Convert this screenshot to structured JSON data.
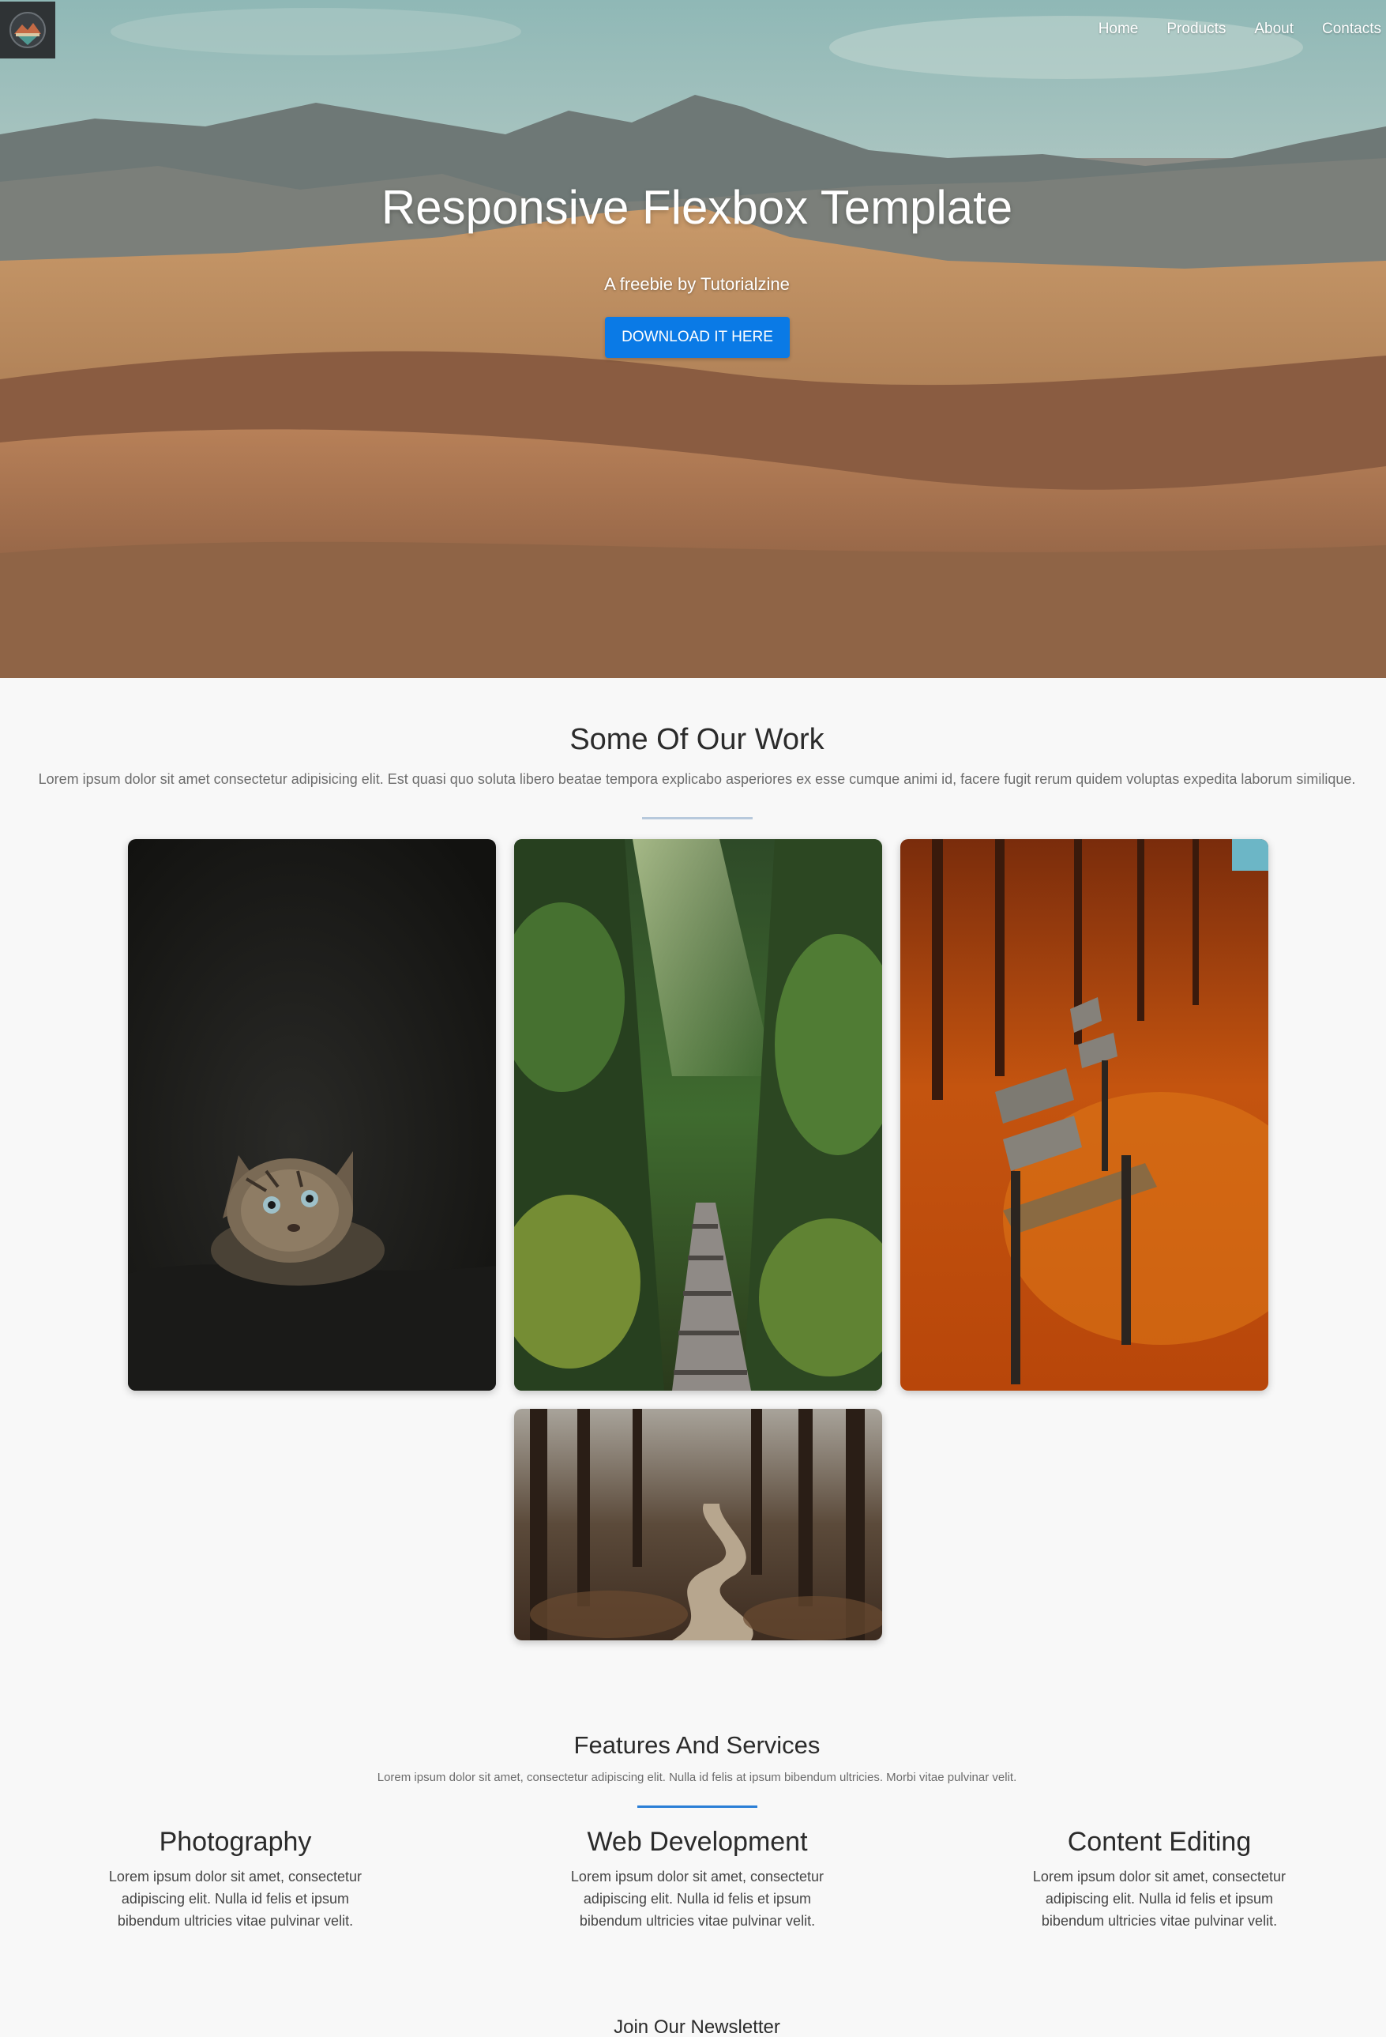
{
  "header": {
    "logo_icon": "mountain-badge-logo",
    "nav": [
      "Home",
      "Products",
      "About",
      "Contacts"
    ]
  },
  "hero": {
    "title": "Responsive Flexbox Template",
    "subtitle": "A freebie by Tutorialzine",
    "cta_label": "DOWNLOAD IT HERE",
    "cta_color": "#0a7ae6"
  },
  "work": {
    "title": "Some Of Our Work",
    "description": "Lorem ipsum dolor sit amet consectetur adipisicing elit. Est quasi quo soluta libero beatae tempora explicabo asperiores ex esse cumque animi id, facere fugit rerum quidem voluptas expedita laborum similique.",
    "images": [
      "kitten-photo",
      "forest-stairs-photo",
      "autumn-bench-photo",
      "forest-path-photo"
    ]
  },
  "features": {
    "title": "Features And Services",
    "description": "Lorem ipsum dolor sit amet, consectetur adipiscing elit. Nulla id felis at ipsum bibendum ultricies. Morbi vitae pulvinar velit.",
    "accent": "#2b7fd6",
    "items": [
      {
        "title": "Photography",
        "text": "Lorem ipsum dolor sit amet, consectetur adipiscing elit. Nulla id felis et ipsum bibendum ultricies vitae pulvinar velit."
      },
      {
        "title": "Web Development",
        "text": "Lorem ipsum dolor sit amet, consectetur adipiscing elit. Nulla id felis et ipsum bibendum ultricies vitae pulvinar velit."
      },
      {
        "title": "Content Editing",
        "text": "Lorem ipsum dolor sit amet, consectetur adipiscing elit. Nulla id felis et ipsum bibendum ultricies vitae pulvinar velit."
      }
    ]
  },
  "newsletter": {
    "title": "Join Our Newsletter"
  }
}
